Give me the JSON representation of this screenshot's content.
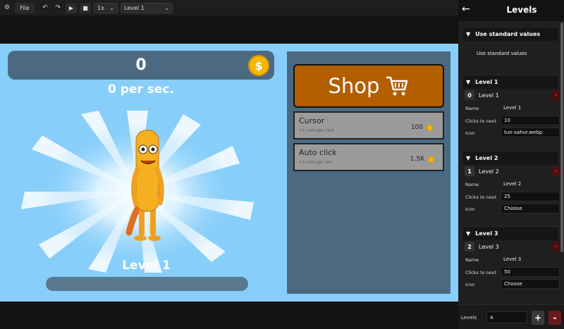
{
  "toolbar": {
    "file_label": "File",
    "speed": "1x",
    "level_select": "Level 1"
  },
  "game": {
    "coins": "0",
    "per_sec": "0 per sec.",
    "level_label": "Level 1",
    "level_progress": 0,
    "shop_label": "Shop",
    "items": [
      {
        "name": "Cursor",
        "desc": "+1 coin per click",
        "price": "100"
      },
      {
        "name": "Auto click",
        "desc": "+1 coin per sec",
        "price": "1.5K"
      }
    ]
  },
  "panel": {
    "title": "Levels",
    "standard": {
      "header": "Use standard values",
      "button": "Use standard values"
    },
    "field_labels": {
      "name": "Name",
      "clicks": "Clicks to next",
      "icon": "Icon"
    },
    "levels": [
      {
        "header": "Level 1",
        "index": "0",
        "title": "Level 1",
        "name": "Level 1",
        "clicks": "10",
        "icon": "tun-sahur.webp"
      },
      {
        "header": "Level 2",
        "index": "1",
        "title": "Level 2",
        "name": "Level 2",
        "clicks": "25",
        "icon": "Choose"
      },
      {
        "header": "Level 3",
        "index": "2",
        "title": "Level 3",
        "name": "Level 3",
        "clicks": "50",
        "icon": "Choose"
      }
    ],
    "footer": {
      "label": "Levels",
      "value": "4",
      "plus": "+",
      "minus": "-"
    }
  },
  "colors": {
    "game_bg": "#87cefa",
    "panel_blue": "#4b6a82",
    "shop_orange": "#b35f00",
    "coin_gold": "#f5b800"
  },
  "icons": [
    "gear-icon",
    "undo-icon",
    "redo-icon",
    "play-icon",
    "stop-icon",
    "coin-icon",
    "cart-icon",
    "back-arrow-icon",
    "triangle-down-icon"
  ]
}
